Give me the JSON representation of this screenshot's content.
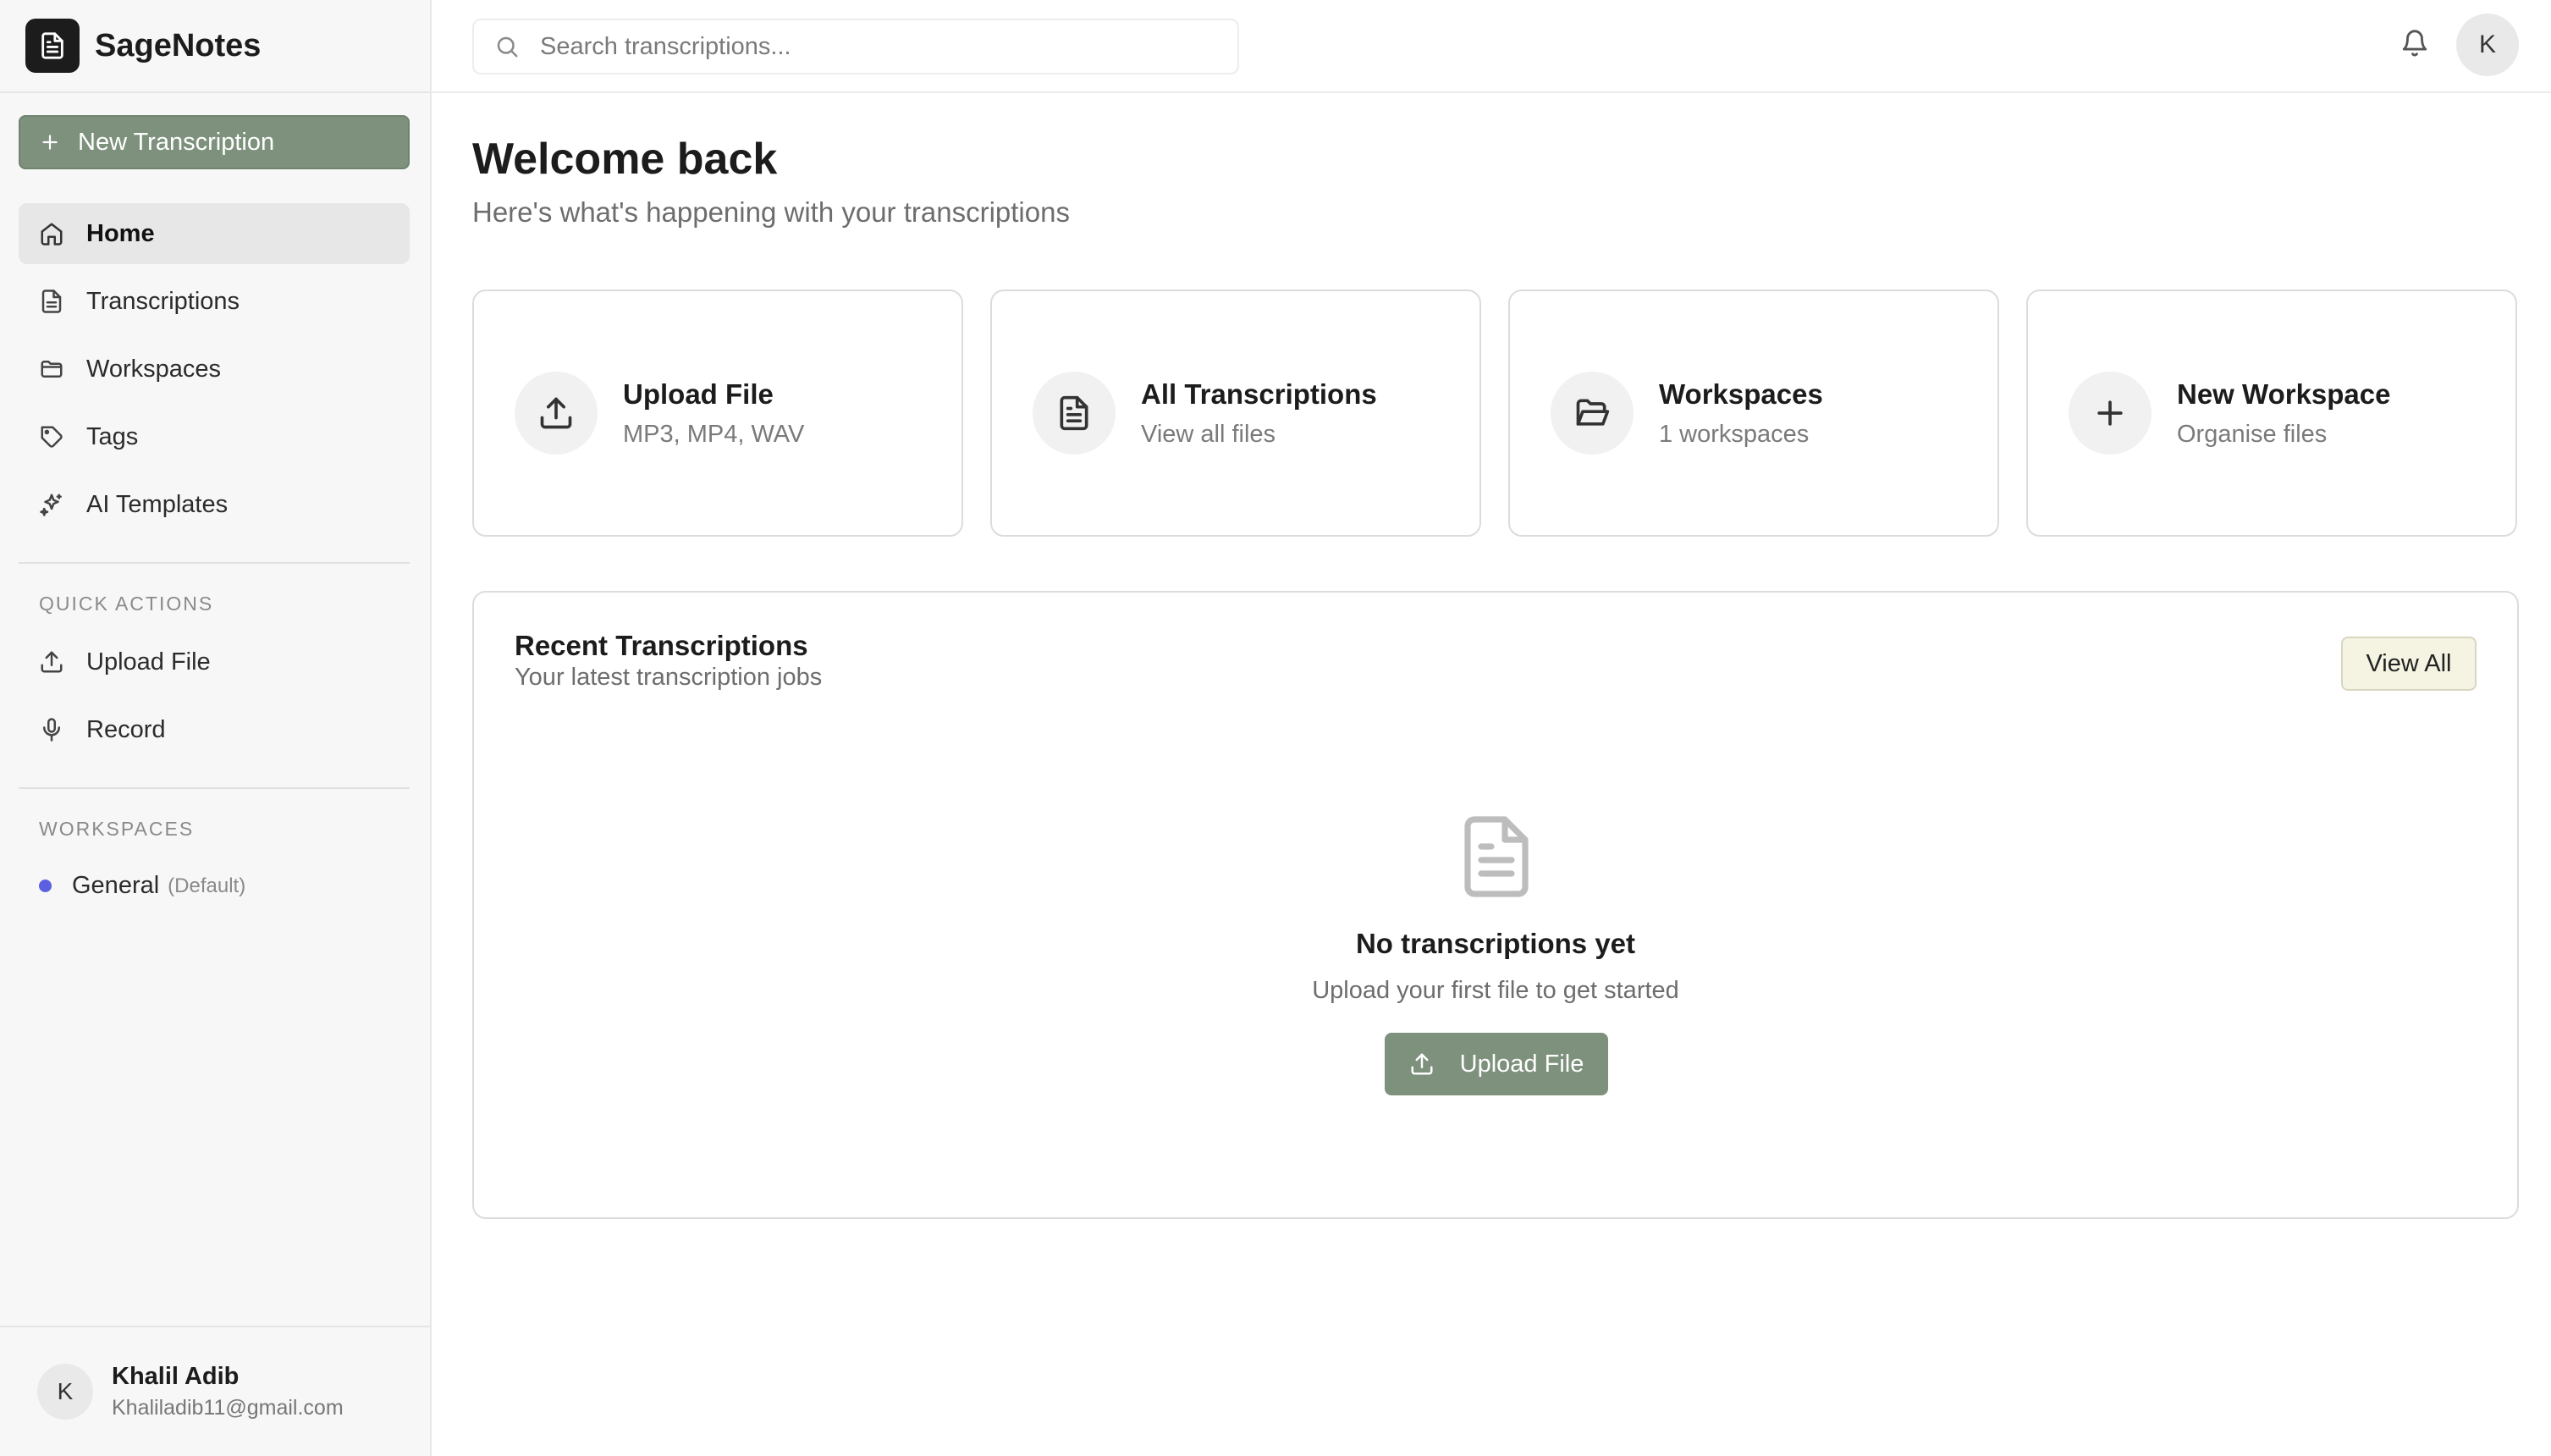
{
  "colors": {
    "accent": "#7d917d",
    "workspace_dot": "#5b5fe0",
    "view_all_bg": "#f5f3e2"
  },
  "brand": {
    "name": "SageNotes",
    "logo_icon": "document-icon"
  },
  "sidebar": {
    "new_button": "New Transcription",
    "nav": [
      {
        "label": "Home",
        "icon": "home-icon",
        "active": true
      },
      {
        "label": "Transcriptions",
        "icon": "file-text-icon"
      },
      {
        "label": "Workspaces",
        "icon": "folder-icon"
      },
      {
        "label": "Tags",
        "icon": "tag-icon"
      },
      {
        "label": "AI Templates",
        "icon": "sparkles-icon"
      }
    ],
    "quick_actions_label": "QUICK ACTIONS",
    "quick_actions": [
      {
        "label": "Upload File",
        "icon": "upload-icon"
      },
      {
        "label": "Record",
        "icon": "microphone-icon"
      }
    ],
    "workspaces_label": "WORKSPACES",
    "workspaces": [
      {
        "name": "General",
        "tag": "(Default)"
      }
    ],
    "user": {
      "initial": "K",
      "name": "Khalil Adib",
      "email": "Khaliladib11@gmail.com"
    }
  },
  "topbar": {
    "search_placeholder": "Search transcriptions...",
    "avatar_initial": "K"
  },
  "main": {
    "title": "Welcome back",
    "subtitle": "Here's what's happening with your transcriptions",
    "cards": [
      {
        "title": "Upload File",
        "subtitle": "MP3, MP4, WAV",
        "icon": "upload-icon"
      },
      {
        "title": "All Transcriptions",
        "subtitle": "View all files",
        "icon": "file-text-icon"
      },
      {
        "title": "Workspaces",
        "subtitle": "1 workspaces",
        "icon": "folder-open-icon"
      },
      {
        "title": "New Workspace",
        "subtitle": "Organise files",
        "icon": "plus-icon"
      }
    ],
    "recent": {
      "title": "Recent Transcriptions",
      "subtitle": "Your latest transcription jobs",
      "view_all": "View All",
      "empty_title": "No transcriptions yet",
      "empty_subtitle": "Upload your first file to get started",
      "upload_button": "Upload File"
    }
  }
}
